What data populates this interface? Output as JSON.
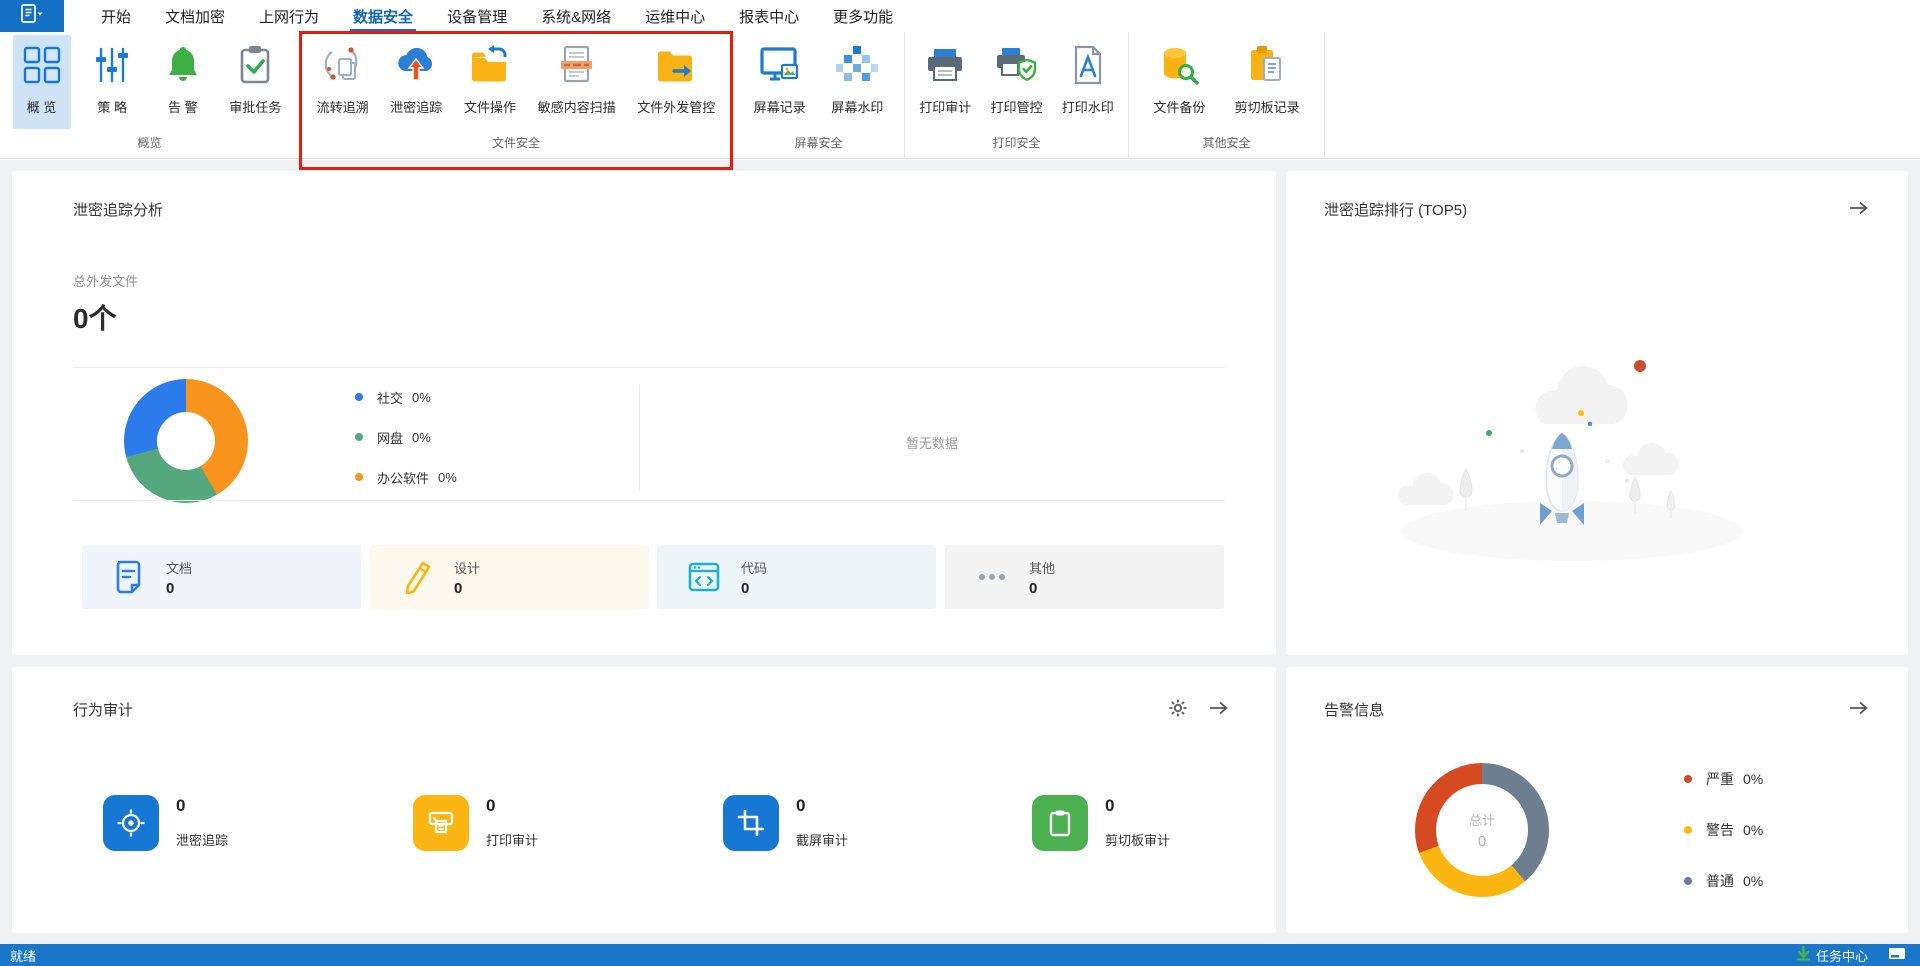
{
  "menubar": {
    "tabs": [
      {
        "label": "开始",
        "active": false
      },
      {
        "label": "文档加密",
        "active": false
      },
      {
        "label": "上网行为",
        "active": false
      },
      {
        "label": "数据安全",
        "active": true
      },
      {
        "label": "设备管理",
        "active": false
      },
      {
        "label": "系统&网络",
        "active": false
      },
      {
        "label": "运维中心",
        "active": false
      },
      {
        "label": "报表中心",
        "active": false
      },
      {
        "label": "更多功能",
        "active": false
      }
    ]
  },
  "ribbon": {
    "annotation_box_color": "#ec1c0d",
    "groups": [
      {
        "label": "概览",
        "buttons": [
          {
            "label": "概 览",
            "selected": true
          },
          {
            "label": "策 略"
          },
          {
            "label": "告 警"
          },
          {
            "label": "审批任务"
          }
        ]
      },
      {
        "label": "文件安全",
        "highlighted": true,
        "buttons": [
          {
            "label": "流转追溯"
          },
          {
            "label": "泄密追踪"
          },
          {
            "label": "文件操作"
          },
          {
            "label": "敏感内容扫描"
          },
          {
            "label": "文件外发管控"
          }
        ]
      },
      {
        "label": "屏幕安全",
        "buttons": [
          {
            "label": "屏幕记录"
          },
          {
            "label": "屏幕水印"
          }
        ]
      },
      {
        "label": "打印安全",
        "buttons": [
          {
            "label": "打印审计"
          },
          {
            "label": "打印管控"
          },
          {
            "label": "打印水印"
          }
        ]
      },
      {
        "label": "其他安全",
        "buttons": [
          {
            "label": "文件备份"
          },
          {
            "label": "剪切板记录"
          }
        ]
      }
    ]
  },
  "cards": {
    "trace_analysis": {
      "title": "泄密追踪分析",
      "total_label": "总外发文件",
      "total_value": "0个",
      "donut": {
        "segments": [
          {
            "label": "社交",
            "value": "0%",
            "color": "#2c7bea"
          },
          {
            "label": "网盘",
            "value": "0%",
            "color": "#55a87e"
          },
          {
            "label": "办公软件",
            "value": "0%",
            "color": "#f8941d"
          }
        ]
      },
      "empty_text": "暂无数据",
      "stats": [
        {
          "label": "文档",
          "value": "0"
        },
        {
          "label": "设计",
          "value": "0"
        },
        {
          "label": "代码",
          "value": "0"
        },
        {
          "label": "其他",
          "value": "0"
        }
      ]
    },
    "trace_rank": {
      "title": "泄密追踪排行 (TOP5)"
    },
    "behavior_audit": {
      "title": "行为审计",
      "items": [
        {
          "label": "泄密追踪",
          "value": "0",
          "color": "#1678d3"
        },
        {
          "label": "打印审计",
          "value": "0",
          "color": "#fcb613"
        },
        {
          "label": "截屏审计",
          "value": "0",
          "color": "#1678d3"
        },
        {
          "label": "剪切板审计",
          "value": "0",
          "color": "#4caf50"
        }
      ]
    },
    "alerts": {
      "title": "告警信息",
      "donut": {
        "center_label": "总计",
        "center_value": "0",
        "segments": [
          {
            "label": "严重",
            "value": "0%",
            "color": "#d54a21"
          },
          {
            "label": "警告",
            "value": "0%",
            "color": "#fbb612"
          },
          {
            "label": "普通",
            "value": "0%",
            "color": "#6d7e90"
          }
        ]
      }
    }
  },
  "statusbar": {
    "left": "就绪",
    "task_center": "任务中心"
  },
  "colors": {
    "brand_blue": "#1668c0",
    "app_button_bg": "#1470c4",
    "ribbon_selected_bg": "#cfe3f6",
    "statusbar_bg": "#1976c8"
  },
  "chart_data": [
    {
      "type": "pie",
      "title": "泄密追踪分析 外发渠道占比",
      "categories": [
        "社交",
        "网盘",
        "办公软件"
      ],
      "values": [
        0,
        0,
        0
      ],
      "labels_shown": [
        "社交 0%",
        "网盘 0%",
        "办公软件 0%"
      ],
      "colors": [
        "#2c7bea",
        "#55a87e",
        "#f8941d"
      ],
      "note": "总外发文件 0个，右侧列表区域显示 暂无数据",
      "legend_position": "right"
    },
    {
      "type": "pie",
      "title": "告警信息",
      "categories": [
        "严重",
        "警告",
        "普通"
      ],
      "values": [
        0,
        0,
        0
      ],
      "labels_shown": [
        "严重 0%",
        "警告 0%",
        "普通 0%"
      ],
      "colors": [
        "#d54a21",
        "#fbb612",
        "#6d7e90"
      ],
      "center_label": "总计",
      "center_value": 0,
      "legend_position": "right"
    }
  ]
}
